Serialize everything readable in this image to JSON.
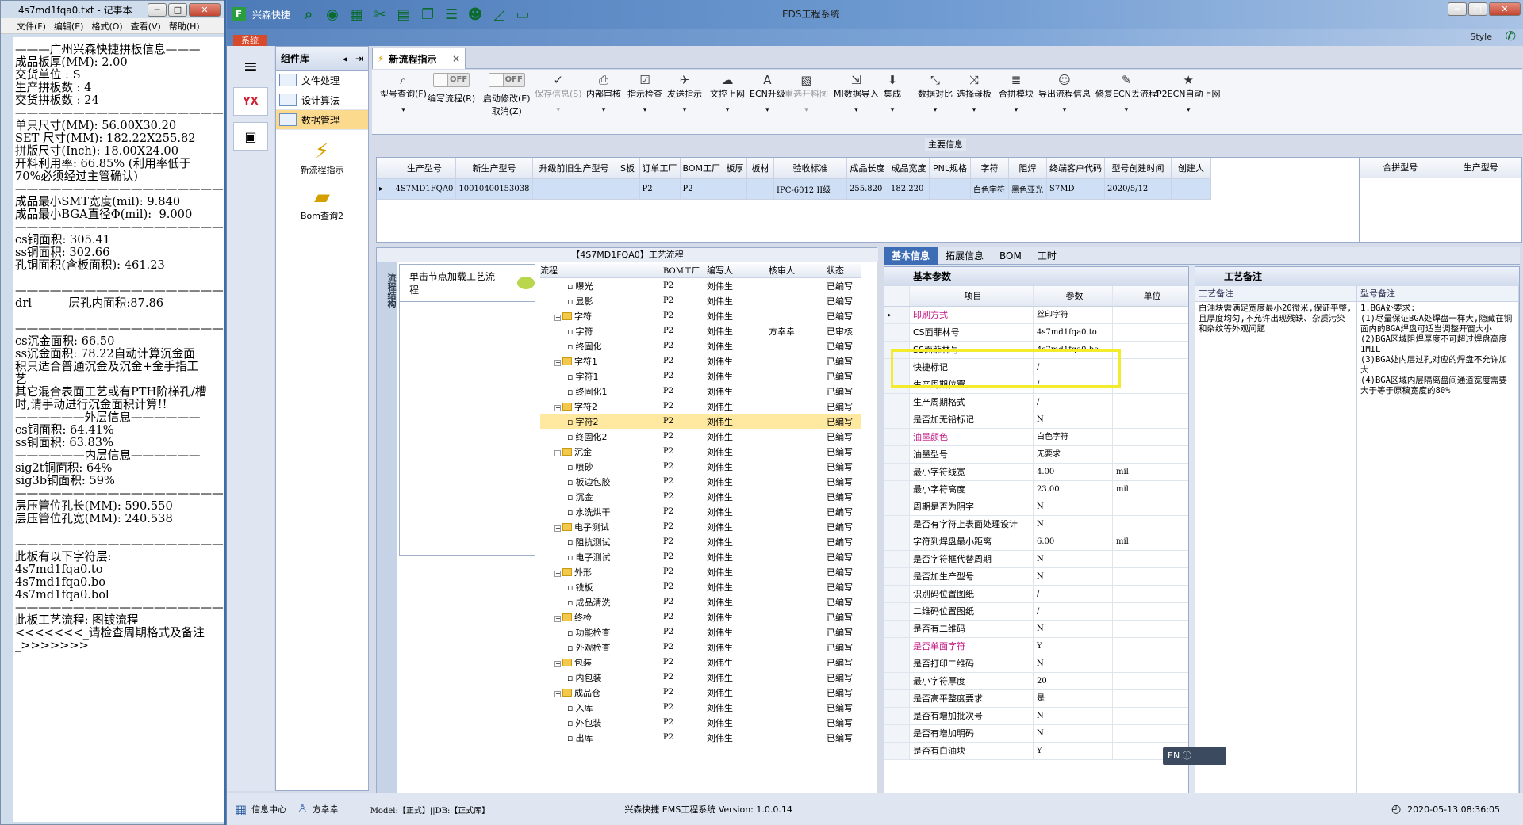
{
  "notepad": {
    "title": "4s7md1fqa0.txt - 记事本",
    "menu": [
      "文件(F)",
      "编辑(E)",
      "格式(O)",
      "查看(V)",
      "帮助(H)"
    ],
    "lines": [
      "———广州兴森快捷拼板信息———",
      "成品板厚(MM): 2.00",
      "交货单位 : S",
      "生产拼板数 : 4",
      "交货拼板数 : 24",
      "——————————————————",
      "单只尺寸(MM): 56.00X30.20",
      "SET 尺寸(MM): 182.22X255.82",
      "拼版尺寸(Inch): 18.00X24.00",
      "开料利用率: 66.85% (利用率低于",
      "70%必须经过主管确认)",
      "——————————————————",
      "成品最小SMT宽度(mil): 9.840",
      "成品最小BGA直径Φ(mil):  9.000",
      "——————————————————",
      "cs铜面积: 305.41",
      "ss铜面积: 302.66",
      "孔铜面积(含板面积): 461.23",
      "",
      "——————————————————",
      "drl          层孔内面积:87.86",
      "",
      "——————————————————",
      "cs沉金面积: 66.50",
      "ss沉金面积: 78.22自动计算沉金面",
      "积只适合普通沉金及沉金+金手指工",
      "艺",
      "其它混合表面工艺或有PTH阶梯孔/槽",
      "时,请手动进行沉金面积计算!!",
      "——————外层信息——————",
      "cs铜面积: 64.41%",
      "ss铜面积: 63.83%",
      "——————内层信息——————",
      "sig2t铜面积: 64%",
      "sig3b铜面积: 59%",
      "——————————————————",
      "层压管位孔长(MM): 590.550",
      "层压管位孔宽(MM): 240.538",
      "",
      "——————————————————",
      "此板有以下字符层:",
      "4s7md1fqa0.to",
      "4s7md1fqa0.bo",
      "4s7md1fqa0.bol",
      "——————————————————",
      "此板工艺流程: 图镀流程",
      "<<<<<<<_请检查周期格式及备注",
      "_>>>>>>>"
    ]
  },
  "app": {
    "title": "EDS工程系统",
    "quick_label": "兴森快捷",
    "sys_tab": "系统",
    "style_label": "Style"
  },
  "left": {
    "comp_title": "组件库",
    "items": [
      "文件处理",
      "设计算法",
      "数据管理"
    ],
    "big_items": [
      "新流程指示",
      "Bom查询2"
    ]
  },
  "tab": {
    "label": "新流程指示"
  },
  "toolbar": {
    "buttons": [
      "型号查询(F)",
      "编写流程(R)",
      "启动修改(E)",
      "取消(Z)",
      "保存信息(S)",
      "内部审核",
      "指示检查",
      "发送指示",
      "文控上网",
      "ECN升级",
      "重选开料图",
      "MI数据导入",
      "集成",
      "数据对比",
      "选择母板",
      "合拼模块",
      "导出流程信息",
      "修复ECN丢流程",
      "P2ECN自动上网"
    ],
    "off": "OFF"
  },
  "main_info": {
    "legend": "主要信息",
    "headers": [
      "生产型号",
      "新生产型号",
      "升级前旧生产型号",
      "S板",
      "订单工厂",
      "BOM工厂",
      "板厚",
      "板材",
      "验收标准",
      "成品长度",
      "成品宽度",
      "PNL规格",
      "字符",
      "阻焊",
      "终端客户代码",
      "型号创建时间",
      "创建人"
    ],
    "row": [
      "4S7MD1FQA0",
      "10010400153038",
      "",
      "",
      "P2",
      "P2",
      "",
      "",
      "IPC-6012 II级",
      "255.820",
      "182.220",
      "",
      "白色字符",
      "黑色亚光",
      "S7MD",
      "2020/5/12",
      ""
    ],
    "side_headers": [
      "合拼型号",
      "生产型号"
    ]
  },
  "flow": {
    "caption": "【4S7MD1FQA0】工艺流程",
    "side": "流程结构",
    "node": "单击节点加载工艺流程",
    "headers": [
      "流程",
      "BOM工厂",
      "编写人",
      "核审人",
      "状态"
    ],
    "rows": [
      {
        "n": "曝光",
        "lv": 2,
        "b": "P2",
        "w": "刘伟生",
        "r": "",
        "s": "已编写"
      },
      {
        "n": "显影",
        "lv": 2,
        "b": "P2",
        "w": "刘伟生",
        "r": "",
        "s": "已编写"
      },
      {
        "n": "字符",
        "lv": 1,
        "b": "P2",
        "w": "刘伟生",
        "r": "",
        "s": "已编写"
      },
      {
        "n": "字符",
        "lv": 2,
        "b": "P2",
        "w": "刘伟生",
        "r": "方幸幸",
        "s": "已审核"
      },
      {
        "n": "终固化",
        "lv": 2,
        "b": "P2",
        "w": "刘伟生",
        "r": "",
        "s": "已编写"
      },
      {
        "n": "字符1",
        "lv": 1,
        "b": "P2",
        "w": "刘伟生",
        "r": "",
        "s": "已编写"
      },
      {
        "n": "字符1",
        "lv": 2,
        "b": "P2",
        "w": "刘伟生",
        "r": "",
        "s": "已编写"
      },
      {
        "n": "终固化1",
        "lv": 2,
        "b": "P2",
        "w": "刘伟生",
        "r": "",
        "s": "已编写"
      },
      {
        "n": "字符2",
        "lv": 1,
        "b": "P2",
        "w": "刘伟生",
        "r": "",
        "s": "已编写"
      },
      {
        "n": "字符2",
        "lv": 2,
        "b": "P2",
        "w": "刘伟生",
        "r": "",
        "s": "已编写",
        "hl": true
      },
      {
        "n": "终固化2",
        "lv": 2,
        "b": "P2",
        "w": "刘伟生",
        "r": "",
        "s": "已编写"
      },
      {
        "n": "沉金",
        "lv": 1,
        "b": "P2",
        "w": "刘伟生",
        "r": "",
        "s": "已编写"
      },
      {
        "n": "喷砂",
        "lv": 2,
        "b": "P2",
        "w": "刘伟生",
        "r": "",
        "s": "已编写"
      },
      {
        "n": "板边包胶",
        "lv": 2,
        "b": "P2",
        "w": "刘伟生",
        "r": "",
        "s": "已编写"
      },
      {
        "n": "沉金",
        "lv": 2,
        "b": "P2",
        "w": "刘伟生",
        "r": "",
        "s": "已编写"
      },
      {
        "n": "水洗烘干",
        "lv": 2,
        "b": "P2",
        "w": "刘伟生",
        "r": "",
        "s": "已编写"
      },
      {
        "n": "电子测试",
        "lv": 1,
        "b": "P2",
        "w": "刘伟生",
        "r": "",
        "s": "已编写"
      },
      {
        "n": "阻抗测试",
        "lv": 2,
        "b": "P2",
        "w": "刘伟生",
        "r": "",
        "s": "已编写"
      },
      {
        "n": "电子测试",
        "lv": 2,
        "b": "P2",
        "w": "刘伟生",
        "r": "",
        "s": "已编写"
      },
      {
        "n": "外形",
        "lv": 1,
        "b": "P2",
        "w": "刘伟生",
        "r": "",
        "s": "已编写"
      },
      {
        "n": "铣板",
        "lv": 2,
        "b": "P2",
        "w": "刘伟生",
        "r": "",
        "s": "已编写"
      },
      {
        "n": "成品清洗",
        "lv": 2,
        "b": "P2",
        "w": "刘伟生",
        "r": "",
        "s": "已编写"
      },
      {
        "n": "终检",
        "lv": 1,
        "b": "P2",
        "w": "刘伟生",
        "r": "",
        "s": "已编写"
      },
      {
        "n": "功能检查",
        "lv": 2,
        "b": "P2",
        "w": "刘伟生",
        "r": "",
        "s": "已编写"
      },
      {
        "n": "外观检查",
        "lv": 2,
        "b": "P2",
        "w": "刘伟生",
        "r": "",
        "s": "已编写"
      },
      {
        "n": "包装",
        "lv": 1,
        "b": "P2",
        "w": "刘伟生",
        "r": "",
        "s": "已编写"
      },
      {
        "n": "内包装",
        "lv": 2,
        "b": "P2",
        "w": "刘伟生",
        "r": "",
        "s": "已编写"
      },
      {
        "n": "成品仓",
        "lv": 1,
        "b": "P2",
        "w": "刘伟生",
        "r": "",
        "s": "已编写"
      },
      {
        "n": "入库",
        "lv": 2,
        "b": "P2",
        "w": "刘伟生",
        "r": "",
        "s": "已编写"
      },
      {
        "n": "外包装",
        "lv": 2,
        "b": "P2",
        "w": "刘伟生",
        "r": "",
        "s": "已编写"
      },
      {
        "n": "出库",
        "lv": 2,
        "b": "P2",
        "w": "刘伟生",
        "r": "",
        "s": "已编写"
      }
    ]
  },
  "basic": {
    "tabs": [
      "基本信息",
      "拓展信息",
      "BOM",
      "工时"
    ],
    "title": "基本参数",
    "headers": [
      "项目",
      "参数",
      "单位"
    ],
    "rows": [
      {
        "k": "印刷方式",
        "v": "丝印字符",
        "u": "",
        "pink": true
      },
      {
        "k": "CS面菲林号",
        "v": "4s7md1fqa0.to",
        "u": ""
      },
      {
        "k": "SS面菲林号",
        "v": "4s7md1fqa0.bo",
        "u": ""
      },
      {
        "k": "快捷标记",
        "v": "/",
        "u": ""
      },
      {
        "k": "生产周期位置",
        "v": "/",
        "u": ""
      },
      {
        "k": "生产周期格式",
        "v": "/",
        "u": ""
      },
      {
        "k": "是否加无铅标记",
        "v": "N",
        "u": ""
      },
      {
        "k": "油墨颜色",
        "v": "白色字符",
        "u": "",
        "pink": true
      },
      {
        "k": "油墨型号",
        "v": "无要求",
        "u": ""
      },
      {
        "k": "最小字符线宽",
        "v": "4.00",
        "u": "mil"
      },
      {
        "k": "最小字符高度",
        "v": "23.00",
        "u": "mil"
      },
      {
        "k": "周期是否为阴字",
        "v": "N",
        "u": ""
      },
      {
        "k": "是否有字符上表面处理设计",
        "v": "N",
        "u": ""
      },
      {
        "k": "字符到焊盘最小距离",
        "v": "6.00",
        "u": "mil"
      },
      {
        "k": "是否字符框代替周期",
        "v": "N",
        "u": ""
      },
      {
        "k": "是否加生产型号",
        "v": "N",
        "u": ""
      },
      {
        "k": "识别码位置图纸",
        "v": "/",
        "u": ""
      },
      {
        "k": "二维码位置图纸",
        "v": "/",
        "u": ""
      },
      {
        "k": "是否有二维码",
        "v": "N",
        "u": ""
      },
      {
        "k": "是否单面字符",
        "v": "Y",
        "u": "",
        "pink": true
      },
      {
        "k": "是否打印二维码",
        "v": "N",
        "u": ""
      },
      {
        "k": "最小字符厚度",
        "v": "20",
        "u": ""
      },
      {
        "k": "是否高平整度要求",
        "v": "是",
        "u": ""
      },
      {
        "k": "是否有增加批次号",
        "v": "N",
        "u": ""
      },
      {
        "k": "是否有增加明码",
        "v": "N",
        "u": ""
      },
      {
        "k": "是否有白油块",
        "v": "Y",
        "u": ""
      }
    ]
  },
  "remark": {
    "tab": "工艺备注",
    "col1_title": "工艺备注",
    "col2_title": "型号备注",
    "col1_text": "白油块需满足宽度最小20微米,保证平整,且厚度均匀,不允许出现残缺、杂质污染和杂纹等外观问题",
    "col2_text": "1.BGA处要求:\n(1)尽量保证BGA处焊盘一样大,隐藏在铜面内的BGA焊盘可适当调整开窗大小\n(2)BGA区域阻焊厚度不可超过焊盘高度1MIL\n(3)BGA处内层过孔对应的焊盘不允许加大\n(4)BGA区域内层隔离盘间通道宽度需要大于等于原稿宽度的80%",
    "en": "EN"
  },
  "status": {
    "info": "信息中心",
    "user": "方幸幸",
    "model": "Model:【正式】||DB:【正式库】",
    "center": "兴森快捷  EMS工程系统  Version: 1.0.0.14",
    "datetime": "2020-05-13 08:36:05"
  }
}
